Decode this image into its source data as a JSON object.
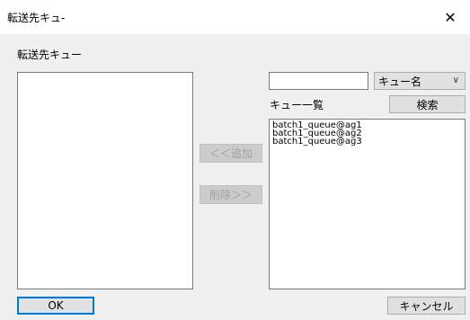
{
  "window": {
    "title": "転送先キュ-",
    "close_glyph": "✕"
  },
  "left_panel": {
    "label": "転送先キュー"
  },
  "buttons": {
    "add": "＜＜追加",
    "remove": "削除＞＞",
    "search": "検索",
    "ok": "OK",
    "cancel": "キャンセル"
  },
  "search": {
    "value": "",
    "placeholder": ""
  },
  "filter": {
    "selected": "キュー名"
  },
  "queue_list": {
    "label": "キュー一覧",
    "items": [
      "batch1_queue@ag1",
      "batch1_queue@ag2",
      "batch1_queue@ag3"
    ]
  }
}
